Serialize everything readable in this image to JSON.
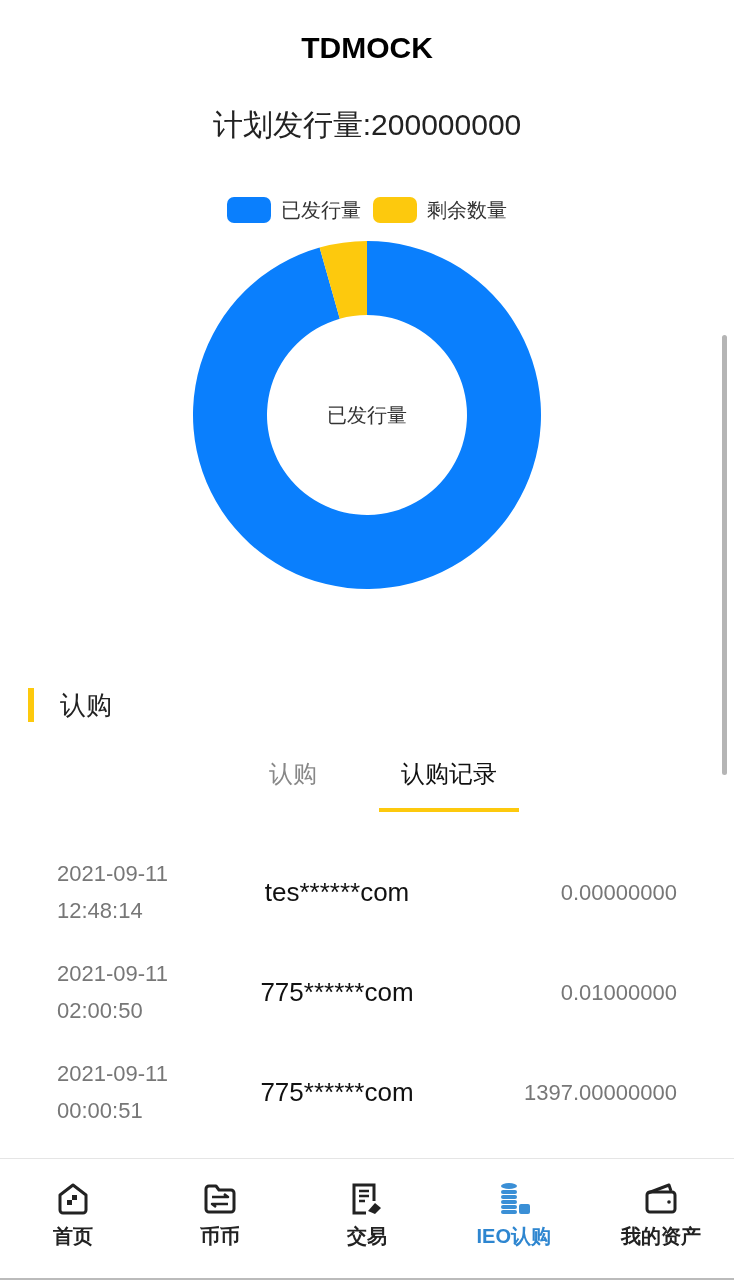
{
  "header": {
    "title": "TDMOCK"
  },
  "plan": {
    "label": "计划发行量:200000000"
  },
  "donut": {
    "legend": [
      {
        "label": "已发行量",
        "color": "#0a7ffd"
      },
      {
        "label": "剩余数量",
        "color": "#fdc90d"
      }
    ],
    "center_label": "已发行量"
  },
  "section": {
    "title": "认购"
  },
  "tabs": [
    {
      "label": "认购",
      "selected": false
    },
    {
      "label": "认购记录",
      "selected": true
    }
  ],
  "records": [
    {
      "date": "2021-09-11",
      "time": "12:48:14",
      "account": "tes******com",
      "amount": "0.00000000"
    },
    {
      "date": "2021-09-11",
      "time": "02:00:50",
      "account": "775******com",
      "amount": "0.01000000"
    },
    {
      "date": "2021-09-11",
      "time": "00:00:51",
      "account": "775******com",
      "amount": "1397.00000000"
    }
  ],
  "bottom_nav": [
    {
      "label": "首页",
      "selected": false
    },
    {
      "label": "币币",
      "selected": false
    },
    {
      "label": "交易",
      "selected": false
    },
    {
      "label": "IEO认购",
      "selected": true
    },
    {
      "label": "我的资产",
      "selected": false
    }
  ]
}
